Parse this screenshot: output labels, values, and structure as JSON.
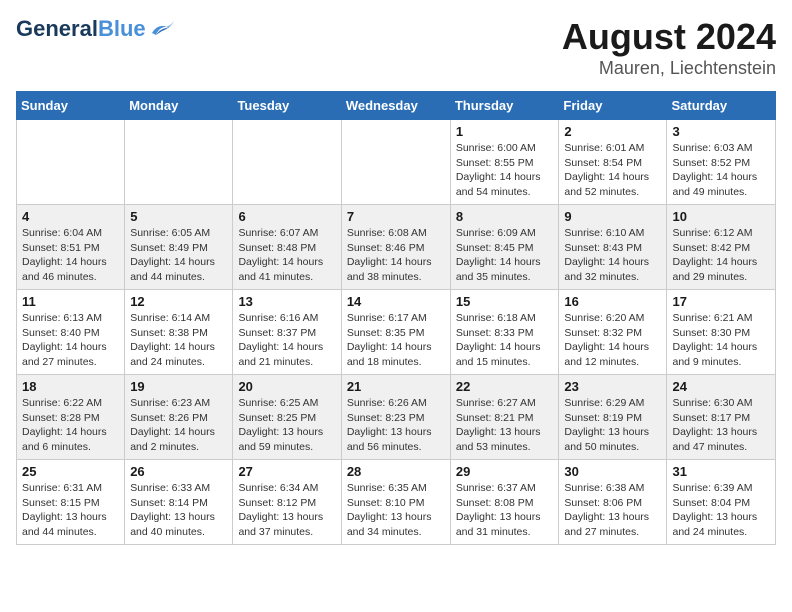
{
  "logo": {
    "part1": "General",
    "part2": "Blue"
  },
  "title": {
    "month": "August 2024",
    "location": "Mauren, Liechtenstein"
  },
  "weekdays": [
    "Sunday",
    "Monday",
    "Tuesday",
    "Wednesday",
    "Thursday",
    "Friday",
    "Saturday"
  ],
  "weeks": [
    [
      {
        "day": "",
        "info": ""
      },
      {
        "day": "",
        "info": ""
      },
      {
        "day": "",
        "info": ""
      },
      {
        "day": "",
        "info": ""
      },
      {
        "day": "1",
        "info": "Sunrise: 6:00 AM\nSunset: 8:55 PM\nDaylight: 14 hours\nand 54 minutes."
      },
      {
        "day": "2",
        "info": "Sunrise: 6:01 AM\nSunset: 8:54 PM\nDaylight: 14 hours\nand 52 minutes."
      },
      {
        "day": "3",
        "info": "Sunrise: 6:03 AM\nSunset: 8:52 PM\nDaylight: 14 hours\nand 49 minutes."
      }
    ],
    [
      {
        "day": "4",
        "info": "Sunrise: 6:04 AM\nSunset: 8:51 PM\nDaylight: 14 hours\nand 46 minutes."
      },
      {
        "day": "5",
        "info": "Sunrise: 6:05 AM\nSunset: 8:49 PM\nDaylight: 14 hours\nand 44 minutes."
      },
      {
        "day": "6",
        "info": "Sunrise: 6:07 AM\nSunset: 8:48 PM\nDaylight: 14 hours\nand 41 minutes."
      },
      {
        "day": "7",
        "info": "Sunrise: 6:08 AM\nSunset: 8:46 PM\nDaylight: 14 hours\nand 38 minutes."
      },
      {
        "day": "8",
        "info": "Sunrise: 6:09 AM\nSunset: 8:45 PM\nDaylight: 14 hours\nand 35 minutes."
      },
      {
        "day": "9",
        "info": "Sunrise: 6:10 AM\nSunset: 8:43 PM\nDaylight: 14 hours\nand 32 minutes."
      },
      {
        "day": "10",
        "info": "Sunrise: 6:12 AM\nSunset: 8:42 PM\nDaylight: 14 hours\nand 29 minutes."
      }
    ],
    [
      {
        "day": "11",
        "info": "Sunrise: 6:13 AM\nSunset: 8:40 PM\nDaylight: 14 hours\nand 27 minutes."
      },
      {
        "day": "12",
        "info": "Sunrise: 6:14 AM\nSunset: 8:38 PM\nDaylight: 14 hours\nand 24 minutes."
      },
      {
        "day": "13",
        "info": "Sunrise: 6:16 AM\nSunset: 8:37 PM\nDaylight: 14 hours\nand 21 minutes."
      },
      {
        "day": "14",
        "info": "Sunrise: 6:17 AM\nSunset: 8:35 PM\nDaylight: 14 hours\nand 18 minutes."
      },
      {
        "day": "15",
        "info": "Sunrise: 6:18 AM\nSunset: 8:33 PM\nDaylight: 14 hours\nand 15 minutes."
      },
      {
        "day": "16",
        "info": "Sunrise: 6:20 AM\nSunset: 8:32 PM\nDaylight: 14 hours\nand 12 minutes."
      },
      {
        "day": "17",
        "info": "Sunrise: 6:21 AM\nSunset: 8:30 PM\nDaylight: 14 hours\nand 9 minutes."
      }
    ],
    [
      {
        "day": "18",
        "info": "Sunrise: 6:22 AM\nSunset: 8:28 PM\nDaylight: 14 hours\nand 6 minutes."
      },
      {
        "day": "19",
        "info": "Sunrise: 6:23 AM\nSunset: 8:26 PM\nDaylight: 14 hours\nand 2 minutes."
      },
      {
        "day": "20",
        "info": "Sunrise: 6:25 AM\nSunset: 8:25 PM\nDaylight: 13 hours\nand 59 minutes."
      },
      {
        "day": "21",
        "info": "Sunrise: 6:26 AM\nSunset: 8:23 PM\nDaylight: 13 hours\nand 56 minutes."
      },
      {
        "day": "22",
        "info": "Sunrise: 6:27 AM\nSunset: 8:21 PM\nDaylight: 13 hours\nand 53 minutes."
      },
      {
        "day": "23",
        "info": "Sunrise: 6:29 AM\nSunset: 8:19 PM\nDaylight: 13 hours\nand 50 minutes."
      },
      {
        "day": "24",
        "info": "Sunrise: 6:30 AM\nSunset: 8:17 PM\nDaylight: 13 hours\nand 47 minutes."
      }
    ],
    [
      {
        "day": "25",
        "info": "Sunrise: 6:31 AM\nSunset: 8:15 PM\nDaylight: 13 hours\nand 44 minutes."
      },
      {
        "day": "26",
        "info": "Sunrise: 6:33 AM\nSunset: 8:14 PM\nDaylight: 13 hours\nand 40 minutes."
      },
      {
        "day": "27",
        "info": "Sunrise: 6:34 AM\nSunset: 8:12 PM\nDaylight: 13 hours\nand 37 minutes."
      },
      {
        "day": "28",
        "info": "Sunrise: 6:35 AM\nSunset: 8:10 PM\nDaylight: 13 hours\nand 34 minutes."
      },
      {
        "day": "29",
        "info": "Sunrise: 6:37 AM\nSunset: 8:08 PM\nDaylight: 13 hours\nand 31 minutes."
      },
      {
        "day": "30",
        "info": "Sunrise: 6:38 AM\nSunset: 8:06 PM\nDaylight: 13 hours\nand 27 minutes."
      },
      {
        "day": "31",
        "info": "Sunrise: 6:39 AM\nSunset: 8:04 PM\nDaylight: 13 hours\nand 24 minutes."
      }
    ]
  ]
}
